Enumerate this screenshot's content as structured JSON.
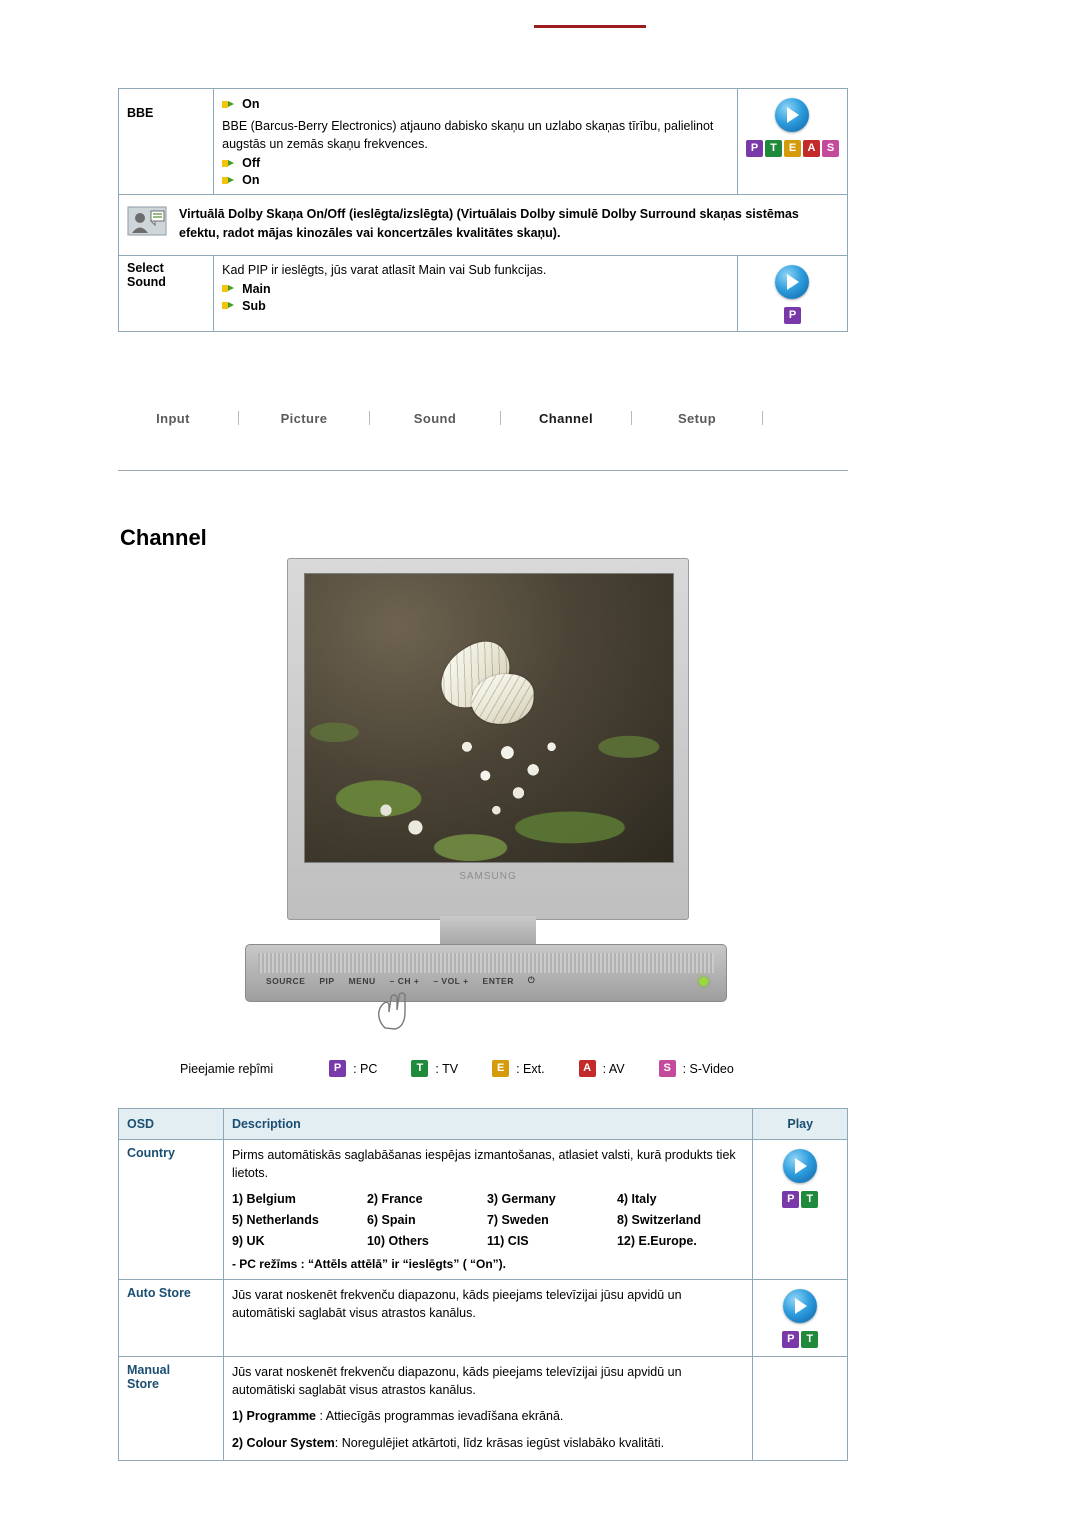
{
  "top_table": {
    "rows": [
      {
        "osd": "",
        "options_top": [
          "On"
        ],
        "label": "BBE",
        "desc": "BBE (Barcus-Berry Electronics) atjauno dabisko skaņu un uzlabo skaņas tīrību, palielinot augstās un zemās skaņu frekvences.",
        "options": [
          "Off",
          "On"
        ],
        "play": {
          "disc": "play",
          "keys": [
            "P",
            "T",
            "E",
            "A",
            "S"
          ]
        }
      },
      {
        "note": "Virtuālā Dolby Skaņa On/Off (ieslēgta/izslēgta) (Virtuālais Dolby simulē Dolby Surround skaņas sistēmas efektu, radot mājas kinozāles vai koncertzāles kvalitātes skaņu)."
      },
      {
        "osd_line1": "Select",
        "osd_line2": "Sound",
        "desc": "Kad PIP ir ieslēgts, jūs varat atlasīt Main vai Sub funkcijas.",
        "options": [
          "Main",
          "Sub"
        ],
        "play": {
          "disc": "play",
          "keys": [
            "P"
          ]
        }
      }
    ]
  },
  "tabs": [
    {
      "label": "Input",
      "active": false
    },
    {
      "label": "Picture",
      "active": false
    },
    {
      "label": "Sound",
      "active": false
    },
    {
      "label": "Channel",
      "active": true
    },
    {
      "label": "Setup",
      "active": false
    }
  ],
  "heading": "Channel",
  "monitor": {
    "brand": "SAMSUNG",
    "buttons": [
      "SOURCE",
      "PIP",
      "MENU",
      "–  CH  +",
      "–  VOL  +",
      "ENTER",
      "⏻"
    ]
  },
  "legend": {
    "label": "Pieejamie reþîmi",
    "items": [
      {
        "key": "P",
        "text": ": PC",
        "color": "k-p"
      },
      {
        "key": "T",
        "text": ": TV",
        "color": "k-t"
      },
      {
        "key": "E",
        "text": ": Ext.",
        "color": "k-e"
      },
      {
        "key": "A",
        "text": ": AV",
        "color": "k-a"
      },
      {
        "key": "S",
        "text": ": S-Video",
        "color": "k-s"
      }
    ]
  },
  "bottom_table": {
    "headers": [
      "OSD",
      "Description",
      "Play"
    ],
    "rows": [
      {
        "label": "Country",
        "desc": "Pirms automātiskās saglabāšanas iespējas izmantošanas, atlasiet valsti, kurā produkts tiek lietots.",
        "countries": [
          [
            "1)  Belgium",
            "2)  France",
            "3)  Germany",
            "4)  Italy"
          ],
          [
            "5)  Netherlands",
            "6)  Spain",
            "7)  Sweden",
            "8)  Switzerland"
          ],
          [
            "9)  UK",
            "10)  Others",
            "11)  CIS",
            "12)  E.Europe."
          ]
        ],
        "note": "- PC režīms :  “Attēls attēlā” ir  “ieslēgts” ( “On”).",
        "play": {
          "disc": "play",
          "keys": [
            "P",
            "T"
          ]
        }
      },
      {
        "label": "Auto Store",
        "desc": "Jūs varat noskenēt frekvenču diapazonu, kāds pieejams televīzijai jūsu apvidū un automātiski saglabāt visus atrastos kanālus.",
        "play": {
          "disc": "play",
          "keys": [
            "P",
            "T"
          ]
        }
      },
      {
        "label_line1": "Manual",
        "label_line2": "Store",
        "desc": "Jūs varat noskenēt frekvenču diapazonu, kāds pieejams televīzijai jūsu apvidū un automātiski saglabāt visus atrastos kanālus.",
        "sub1_bold": "1) Programme",
        "sub1_rest": " : Attiecīgās programmas ievadīšana ekrānā.",
        "sub2_bold": "2) Colour System",
        "sub2_rest": ": Noregulējiet atkārtoti, līdz krāsas iegūst vislabāko kvalitāti."
      }
    ]
  }
}
